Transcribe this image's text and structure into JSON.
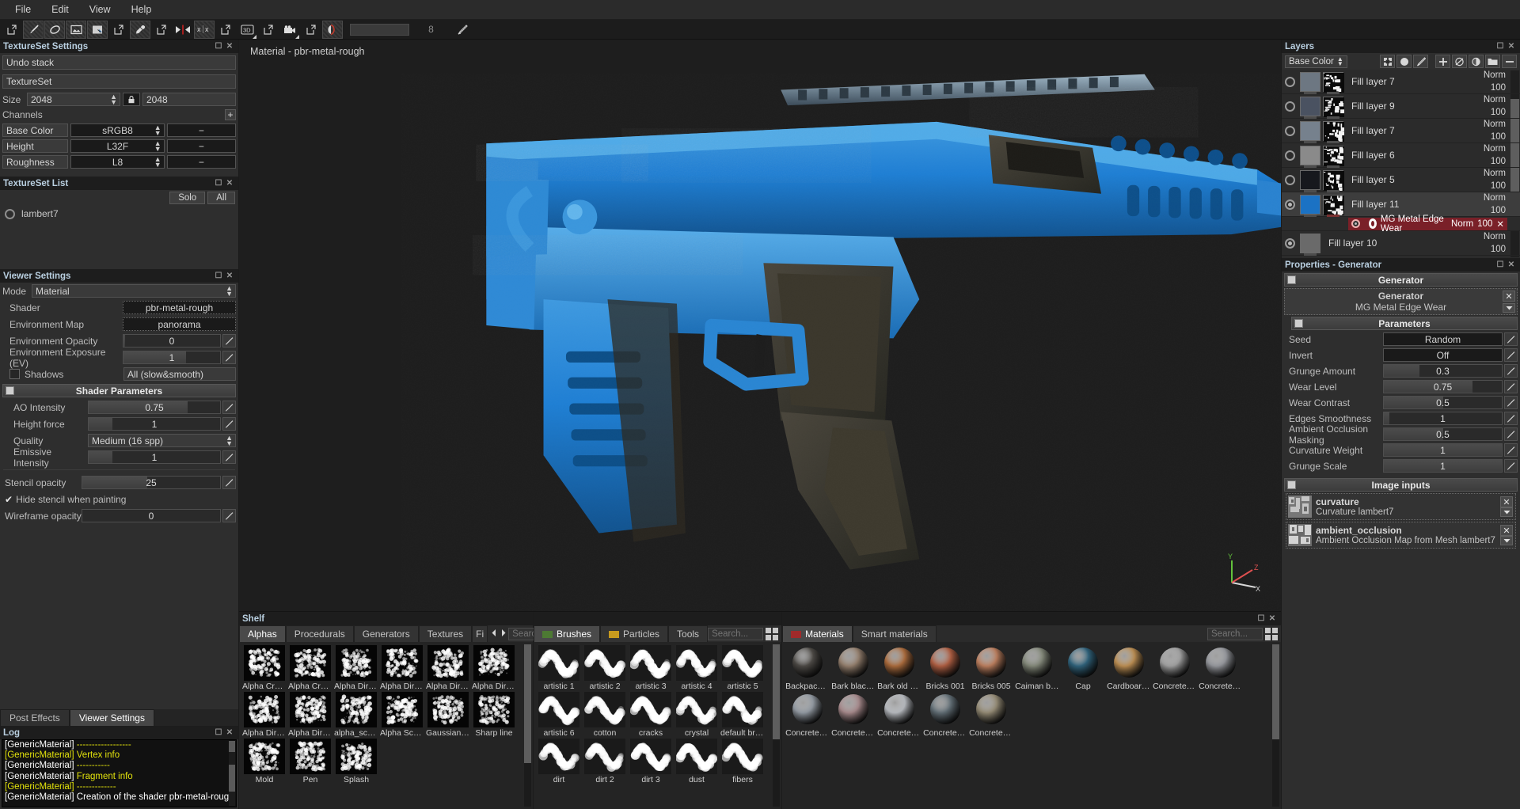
{
  "menu": {
    "items": [
      "File",
      "Edit",
      "View",
      "Help"
    ]
  },
  "toolbar": {
    "brush_size_value": "8",
    "icons": [
      "pointer-tool-icon",
      "paint-brush-icon",
      "eraser-icon",
      "projection-icon",
      "fill-tool-icon",
      "popout-icon",
      "eyedropper-icon",
      "popout-icon",
      "symmetry-icon",
      "symmetry-axis-icon",
      "popout-icon",
      "three-d-view-icon",
      "popout-icon",
      "camera-icon",
      "popout-icon",
      "mask-icon"
    ]
  },
  "texture_set_settings": {
    "panel_title": "TextureSet Settings",
    "undo_stack": "Undo stack",
    "texture_set": "TextureSet",
    "size_label": "Size",
    "size_width": "2048",
    "size_height": "2048",
    "channels_label": "Channels",
    "channels": [
      {
        "name": "Base Color",
        "format": "sRGB8"
      },
      {
        "name": "Height",
        "format": "L32F"
      },
      {
        "name": "Roughness",
        "format": "L8"
      }
    ]
  },
  "textureset_list": {
    "panel_title": "TextureSet List",
    "solo_label": "Solo",
    "all_label": "All",
    "items": [
      "lambert7"
    ]
  },
  "viewer_settings": {
    "panel_title": "Viewer Settings",
    "mode_label": "Mode",
    "mode_value": "Material",
    "rows": [
      {
        "label": "Shader",
        "value": "pbr-metal-rough",
        "type": "dotted"
      },
      {
        "label": "Environment Map",
        "value": "panorama",
        "type": "dotted"
      },
      {
        "label": "Environment Opacity",
        "value": "0",
        "type": "slider",
        "fill": 2
      },
      {
        "label": "Environment Exposure (EV)",
        "value": "1",
        "type": "slider",
        "fill": 65
      },
      {
        "label": "Shadows",
        "value": "All (slow&smooth)",
        "type": "combo",
        "checkbox": true
      }
    ],
    "shader_parameters_label": "Shader Parameters",
    "shader_params": [
      {
        "label": "AO Intensity",
        "value": "0.75",
        "fill": 75
      },
      {
        "label": "Height force",
        "value": "1",
        "fill": 18
      },
      {
        "label": "Quality",
        "value": "Medium (16 spp)",
        "type": "combo"
      },
      {
        "label": "Emissive Intensity",
        "value": "1",
        "fill": 18
      }
    ],
    "stencil_opacity_label": "Stencil opacity",
    "stencil_opacity_value": "25",
    "stencil_opacity_fill": 47,
    "hide_stencil_label": "Hide stencil when painting",
    "hide_stencil_checked": true,
    "wireframe_label": "Wireframe opacity",
    "wireframe_value": "0",
    "wireframe_fill": 0
  },
  "bottom_left_tabs": {
    "tabs": [
      "Post Effects",
      "Viewer Settings"
    ],
    "active": "Viewer Settings"
  },
  "log": {
    "panel_title": "Log",
    "lines": [
      {
        "tag": "[GenericMaterial]",
        "text": " ------------------",
        "color": "white"
      },
      {
        "tag": "[GenericMaterial]",
        "text": " Vertex info",
        "color": "yellow"
      },
      {
        "tag": "[GenericMaterial]",
        "text": " -----------",
        "color": "white"
      },
      {
        "tag": "[GenericMaterial]",
        "text": " Fragment info",
        "color": "yellow"
      },
      {
        "tag": "[GenericMaterial]",
        "text": " -------------",
        "color": "white"
      },
      {
        "tag": "[GenericMaterial]",
        "text": " Creation of the shader pbr-metal-rough successful",
        "color": "white"
      }
    ]
  },
  "viewport": {
    "label": "Material - pbr-metal-rough",
    "axis_x": "X",
    "axis_y": "Y",
    "axis_z": "Z"
  },
  "shelf": {
    "panel_title": "Shelf",
    "tabs": [
      "Alphas",
      "Procedurals",
      "Generators",
      "Textures",
      "Fi"
    ],
    "active_tab": "Alphas",
    "search_placeholder": "Search...",
    "items": [
      "Alpha Cracks ...",
      "Alpha Cracks ...",
      "Alpha Dirt 01",
      "Alpha Dirt 02",
      "Alpha Dirt 03",
      "Alpha Dirt 04",
      "Alpha Dirt 05",
      "Alpha Dirt 06",
      "alpha_scratch...",
      "Alpha Scratch...",
      "Gaussian Noise",
      "Sharp line",
      "Mold",
      "Pen",
      "Splash"
    ]
  },
  "brushes_panel": {
    "tabs": [
      {
        "label": "Brushes",
        "color": "#4d7a33"
      },
      {
        "label": "Particles",
        "color": "#c79a1e"
      },
      {
        "label": "Tools",
        "color": ""
      }
    ],
    "active_tab": "Brushes",
    "search_placeholder": "Search...",
    "items": [
      "artistic 1",
      "artistic 2",
      "artistic 3",
      "artistic 4",
      "artistic 5",
      "artistic 6",
      "cotton",
      "cracks",
      "crystal",
      "default brush",
      "dirt",
      "dirt 2",
      "dirt 3",
      "dust",
      "fibers"
    ]
  },
  "materials_panel": {
    "tabs": [
      {
        "label": "Materials",
        "color": "#a02a2a"
      },
      {
        "label": "Smart materials",
        "color": ""
      }
    ],
    "active_tab": "Materials",
    "search_placeholder": "Search...",
    "items": [
      {
        "name": "Backpack pad...",
        "color": "#4a4743"
      },
      {
        "name": "Bark black pine",
        "color": "#8e7a69"
      },
      {
        "name": "Bark old ginko",
        "color": "#a4673a"
      },
      {
        "name": "Bricks 001",
        "color": "#a85b40"
      },
      {
        "name": "Bricks 005",
        "color": "#b4795a"
      },
      {
        "name": "Caiman back ...",
        "color": "#7d8274"
      },
      {
        "name": "Cap",
        "color": "#2e5f77"
      },
      {
        "name": "Cardboard 001",
        "color": "#b4884f"
      },
      {
        "name": "Concrete 002",
        "color": "#9a9a9a"
      },
      {
        "name": "Concrete 005",
        "color": "#8f9196"
      },
      {
        "name": "Concrete 006",
        "color": "#8d949c"
      },
      {
        "name": "Concrete 010",
        "color": "#a08486"
      },
      {
        "name": "Concrete 011",
        "color": "#b0b3b8"
      },
      {
        "name": "Concrete 044",
        "color": "#5e6a71"
      },
      {
        "name": "Concrete 070",
        "color": "#8e8570"
      }
    ]
  },
  "layers": {
    "panel_title": "Layers",
    "channel_selector": "Base Color",
    "toolbar_icons": [
      "mask-icon",
      "circle-icon",
      "paint-icon",
      "add-layer-icon",
      "add-fill-icon",
      "add-mask-icon",
      "folder-icon",
      "delete-layer-icon"
    ],
    "items": [
      {
        "name": "Fill layer 7",
        "blend": "Norm",
        "opacity": "100",
        "visible": false,
        "thumb": "#6d7782",
        "selected": false
      },
      {
        "name": "Fill layer 9",
        "blend": "Norm",
        "opacity": "100",
        "visible": false,
        "thumb": "#4a5261",
        "selected": false
      },
      {
        "name": "Fill layer 7",
        "blend": "Norm",
        "opacity": "100",
        "visible": false,
        "thumb": "#76818d",
        "selected": false
      },
      {
        "name": "Fill layer 6",
        "blend": "Norm",
        "opacity": "100",
        "visible": false,
        "thumb": "#8a8a8a",
        "selected": false
      },
      {
        "name": "Fill layer 5",
        "blend": "Norm",
        "opacity": "100",
        "visible": false,
        "thumb": "#16181d",
        "selected": false
      },
      {
        "name": "Fill layer 11",
        "blend": "Norm",
        "opacity": "100",
        "visible": true,
        "thumb": "#1b72c4",
        "selected": true,
        "effect": {
          "name": "MG Metal Edge Wear",
          "blend": "Norm",
          "opacity": "100"
        }
      },
      {
        "name": "Fill layer 10",
        "blend": "Norm",
        "opacity": "100",
        "visible": true,
        "thumb": "#6a6a6a",
        "selected": false,
        "no_mask": true
      }
    ]
  },
  "properties": {
    "panel_title": "Properties - Generator",
    "generator_header": "Generator",
    "generator_box_title": "Generator",
    "generator_name": "MG Metal Edge Wear",
    "parameters_header": "Parameters",
    "params": [
      {
        "label": "Seed",
        "value": "Random",
        "type": "button"
      },
      {
        "label": "Invert",
        "value": "Off",
        "type": "button"
      },
      {
        "label": "Grunge Amount",
        "value": "0.3",
        "type": "slider",
        "fill": 30
      },
      {
        "label": "Wear Level",
        "value": "0.75",
        "type": "slider",
        "fill": 75
      },
      {
        "label": "Wear Contrast",
        "value": "0.5",
        "type": "slider",
        "fill": 50
      },
      {
        "label": "Edges Smoothness",
        "value": "1",
        "type": "slider",
        "fill": 5
      },
      {
        "label": "Ambient Occlusion Masking",
        "value": "0.5",
        "type": "slider",
        "fill": 50
      },
      {
        "label": "Curvature Weight",
        "value": "1",
        "type": "slider",
        "fill": 100
      },
      {
        "label": "Grunge Scale",
        "value": "1",
        "type": "slider",
        "fill": 100
      }
    ],
    "image_inputs_header": "Image inputs",
    "image_inputs": [
      {
        "name": "curvature",
        "desc": "Curvature lambert7"
      },
      {
        "name": "ambient_occlusion",
        "desc": "Ambient Occlusion Map from Mesh lambert7"
      }
    ]
  }
}
